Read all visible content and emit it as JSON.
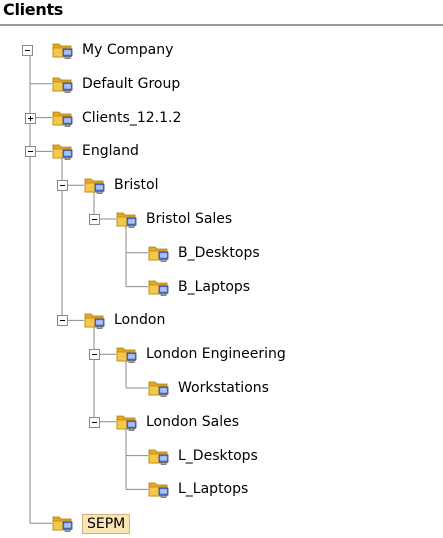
{
  "panel": {
    "title": "Clients"
  },
  "tree": [
    {
      "label": "My Company",
      "depth": 0,
      "expander": "minus"
    },
    {
      "label": "Default Group",
      "depth": 1,
      "expander": "none"
    },
    {
      "label": "Clients_12.1.2",
      "depth": 1,
      "expander": "plus"
    },
    {
      "label": "England",
      "depth": 1,
      "expander": "minus"
    },
    {
      "label": "Bristol",
      "depth": 2,
      "expander": "minus"
    },
    {
      "label": "Bristol Sales",
      "depth": 3,
      "expander": "minus"
    },
    {
      "label": "B_Desktops",
      "depth": 4,
      "expander": "none"
    },
    {
      "label": "B_Laptops",
      "depth": 4,
      "expander": "none"
    },
    {
      "label": "London",
      "depth": 2,
      "expander": "minus"
    },
    {
      "label": "London Engineering",
      "depth": 3,
      "expander": "minus"
    },
    {
      "label": "Workstations",
      "depth": 4,
      "expander": "none"
    },
    {
      "label": "London Sales",
      "depth": 3,
      "expander": "minus"
    },
    {
      "label": "L_Desktops",
      "depth": 4,
      "expander": "none"
    },
    {
      "label": "L_Laptops",
      "depth": 4,
      "expander": "none"
    },
    {
      "label": "SEPM",
      "depth": 1,
      "expander": "none",
      "selected": true
    }
  ],
  "colors": {
    "folder_front": "#f5c84a",
    "folder_back": "#e6a91f",
    "computer_screen": "#5b7fd4",
    "selection_bg": "#f9e4b3",
    "connector": "#8a8a8a"
  }
}
